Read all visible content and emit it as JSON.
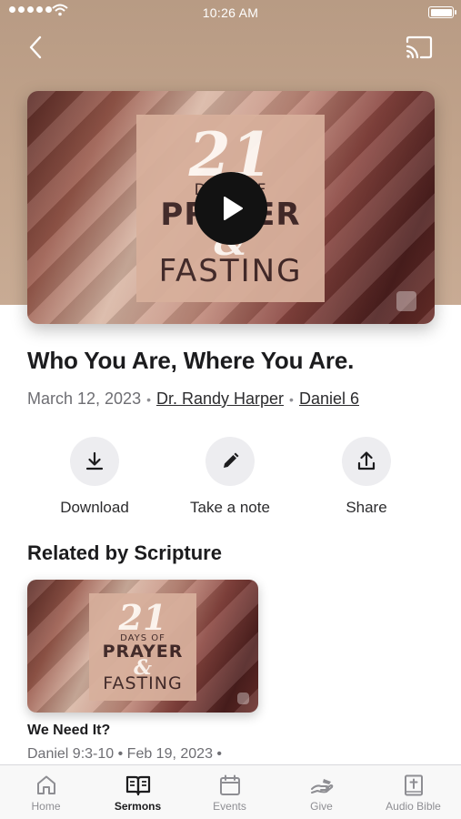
{
  "status_bar": {
    "time": "10:26 AM"
  },
  "header": {
    "back_icon": "chevron-left-icon",
    "cast_icon": "cast-icon"
  },
  "artwork": {
    "number": "21",
    "line1": "DAYS OF",
    "line2": "PRAYER",
    "amp": "&",
    "line3": "FASTING",
    "play_icon": "play-icon"
  },
  "sermon": {
    "title": "Who You Are, Where You Are.",
    "date": "March 12, 2023",
    "speaker": "Dr. Randy Harper",
    "scripture": "Daniel 6"
  },
  "actions": [
    {
      "label": "Download",
      "icon": "download-icon"
    },
    {
      "label": "Take a note",
      "icon": "pencil-icon"
    },
    {
      "label": "Share",
      "icon": "share-icon"
    }
  ],
  "related": {
    "heading": "Related by Scripture",
    "items": [
      {
        "title": "We Need It?",
        "meta": "Daniel 9:3-10 • Feb 19, 2023 •"
      }
    ]
  },
  "tabbar": {
    "tabs": [
      {
        "label": "Home",
        "icon": "home-icon"
      },
      {
        "label": "Sermons",
        "icon": "book-open-icon",
        "active": true
      },
      {
        "label": "Events",
        "icon": "calendar-icon"
      },
      {
        "label": "Give",
        "icon": "giving-hand-icon"
      },
      {
        "label": "Audio Bible",
        "icon": "bible-icon"
      }
    ]
  },
  "colors": {
    "hero_bg": "#c2a48c",
    "active_tab": "#1c1c1e",
    "inactive_tab": "#8e8e93"
  }
}
